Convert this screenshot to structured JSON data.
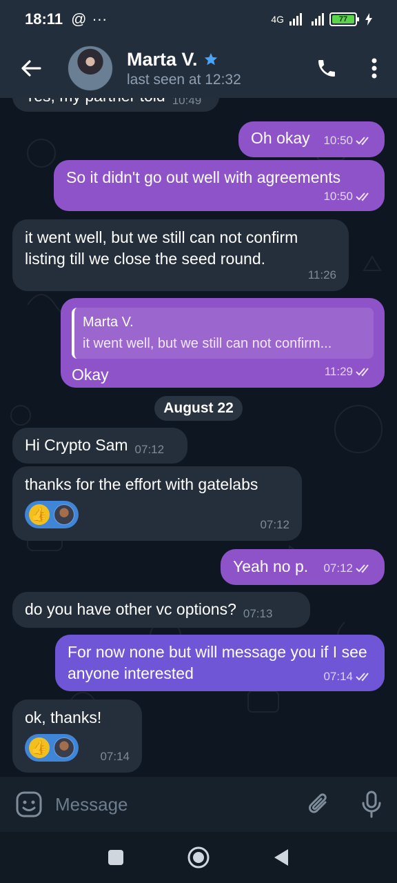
{
  "status_bar": {
    "time": "18:11",
    "at_symbol": "@",
    "dots": "···",
    "network": "4G",
    "battery": "77"
  },
  "header": {
    "name": "Marta V.",
    "last_seen": "last seen at 12:32"
  },
  "messages": [
    {
      "type": "in",
      "text": "Yes, my partner told",
      "time": "10:49"
    },
    {
      "type": "out",
      "text": "Oh okay",
      "time": "10:50"
    },
    {
      "type": "out",
      "text": "So it didn't go out well with agreements",
      "time": "10:50"
    },
    {
      "type": "in",
      "text": "it went well, but we still can not confirm listing till we close the seed round.",
      "time": "11:26"
    },
    {
      "type": "out",
      "reply_name": "Marta V.",
      "reply_text": "it went well, but we still can not confirm...",
      "text": "Okay",
      "time": "11:29"
    },
    {
      "type": "in",
      "text": "Hi Crypto Sam",
      "time": "07:12"
    },
    {
      "type": "in",
      "text": "thanks for the effort with gatelabs",
      "time": "07:12"
    },
    {
      "type": "out",
      "text": "Yeah no p.",
      "time": "07:12"
    },
    {
      "type": "in",
      "text": "do you have other vc options?",
      "time": "07:13"
    },
    {
      "type": "out",
      "text": "For now none but will message you if I see anyone interested",
      "time": "07:14"
    },
    {
      "type": "in",
      "text": "ok, thanks!",
      "time": "07:14"
    }
  ],
  "date_separator": "August 22",
  "composer": {
    "placeholder": "Message"
  },
  "icons": {
    "back": "arrow-left-icon",
    "verified": "star-icon",
    "call": "phone-icon",
    "menu": "more-vertical-icon",
    "sticker": "sticker-icon",
    "attach": "paperclip-icon",
    "mic": "microphone-icon",
    "read": "double-check-icon"
  },
  "colors": {
    "outgoing": "#8e53c9",
    "incoming": "#252f3b",
    "accent": "#3f85d8"
  }
}
